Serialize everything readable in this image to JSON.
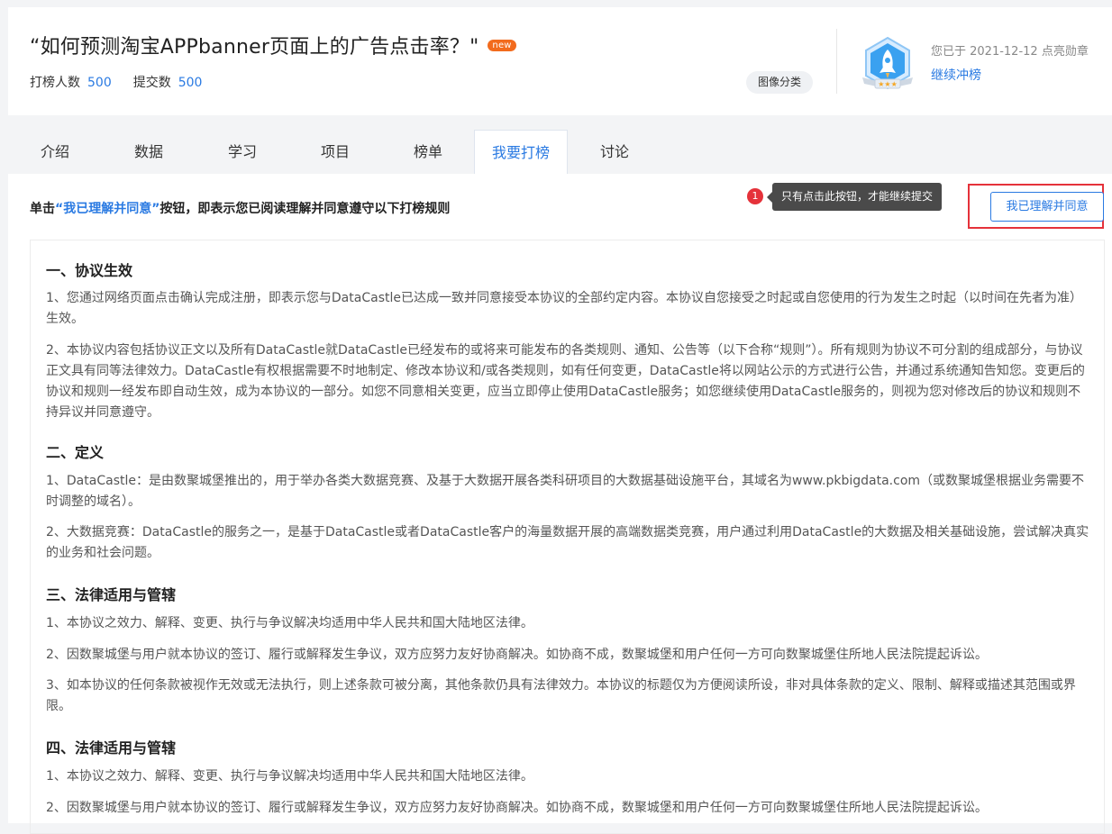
{
  "header": {
    "title": "“如何预测淘宝APPbanner页面上的广告点击率？\"",
    "new_badge": "new",
    "participants_label": "打榜人数",
    "participants_value": "500",
    "submissions_label": "提交数",
    "submissions_value": "500",
    "category_tag": "图像分类",
    "achievement_text": "您已于 2021-12-12 点亮勋章",
    "continue_link": "继续冲榜",
    "medal_icon": "rocket-medal-icon"
  },
  "tabs": [
    {
      "label": "介绍",
      "active": false
    },
    {
      "label": "数据",
      "active": false
    },
    {
      "label": "学习",
      "active": false
    },
    {
      "label": "项目",
      "active": false
    },
    {
      "label": "榜单",
      "active": false
    },
    {
      "label": "我要打榜",
      "active": true
    },
    {
      "label": "讨论",
      "active": false
    }
  ],
  "agree": {
    "prefix": "单击",
    "highlight": "“我已理解并同意”",
    "suffix": "按钮，即表示您已阅读理解并同意遵守以下打榜规则",
    "step_number": "1",
    "tooltip": "只有点击此按钮，才能继续提交",
    "button_label": "我已理解并同意"
  },
  "rules": {
    "s1_title": "一、协议生效",
    "s1_p1": "1、您通过网络页面点击确认完成注册，即表示您与DataCastle已达成一致并同意接受本协议的全部约定内容。本协议自您接受之时起或自您使用的行为发生之时起（以时间在先者为准）生效。",
    "s1_p2": "2、本协议内容包括协议正文以及所有DataCastle就DataCastle已经发布的或将来可能发布的各类规则、通知、公告等（以下合称“规则”）。所有规则为协议不可分割的组成部分，与协议正文具有同等法律效力。DataCastle有权根据需要不时地制定、修改本协议和/或各类规则，如有任何变更，DataCastle将以网站公示的方式进行公告，并通过系统通知告知您。变更后的协议和规则一经发布即自动生效，成为本协议的一部分。如您不同意相关变更，应当立即停止使用DataCastle服务；如您继续使用DataCastle服务的，则视为您对修改后的协议和规则不持异议并同意遵守。",
    "s2_title": "二、定义",
    "s2_p1": "1、DataCastle：是由数聚城堡推出的，用于举办各类大数据竞赛、及基于大数据开展各类科研项目的大数据基础设施平台，其域名为www.pkbigdata.com（或数聚城堡根据业务需要不时调整的域名）。",
    "s2_p2": "2、大数据竞赛：DataCastle的服务之一，是基于DataCastle或者DataCastle客户的海量数据开展的高端数据类竞赛，用户通过利用DataCastle的大数据及相关基础设施，尝试解决真实的业务和社会问题。",
    "s3_title": "三、法律适用与管辖",
    "s3_p1": "1、本协议之效力、解释、变更、执行与争议解决均适用中华人民共和国大陆地区法律。",
    "s3_p2": "2、因数聚城堡与用户就本协议的签订、履行或解释发生争议，双方应努力友好协商解决。如协商不成，数聚城堡和用户任何一方可向数聚城堡住所地人民法院提起诉讼。",
    "s3_p3": "3、如本协议的任何条款被视作无效或无法执行，则上述条款可被分离，其他条款仍具有法律效力。本协议的标题仅为方便阅读所设，非对具体条款的定义、限制、解释或描述其范围或界限。",
    "s4_title": "四、法律适用与管辖",
    "s4_p1": "1、本协议之效力、解释、变更、执行与争议解决均适用中华人民共和国大陆地区法律。",
    "s4_p2": "2、因数聚城堡与用户就本协议的签订、履行或解释发生争议，双方应努力友好协商解决。如协商不成，数聚城堡和用户任何一方可向数聚城堡住所地人民法院提起诉讼。"
  },
  "colors": {
    "accent": "#2a7ae2",
    "badge": "#f26b1d",
    "alert": "#e5323a"
  }
}
